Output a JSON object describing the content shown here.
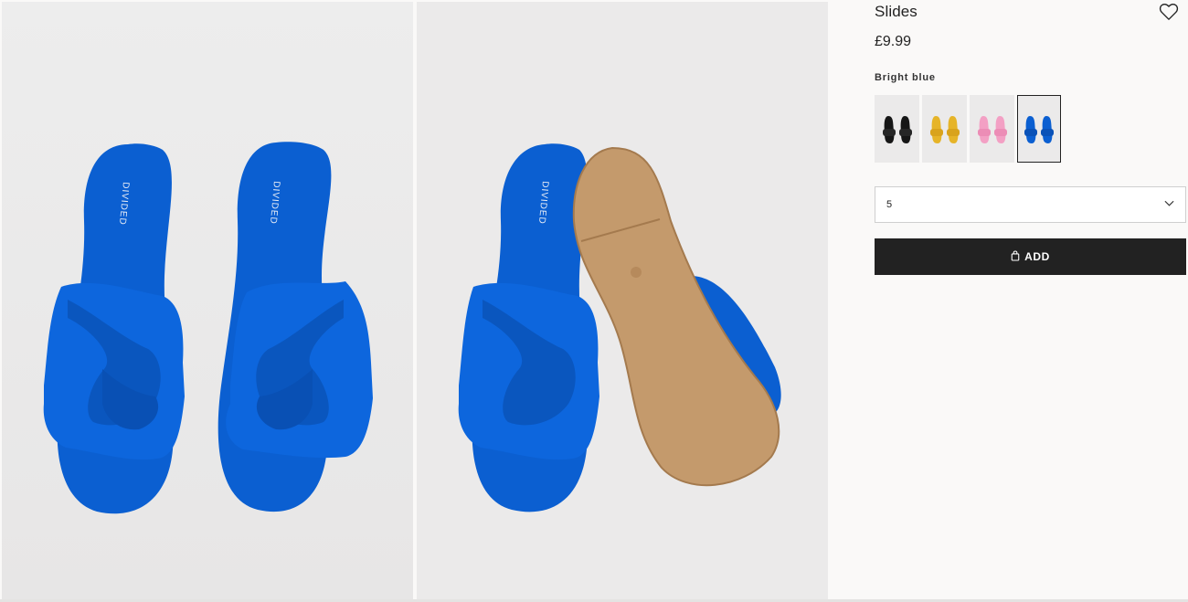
{
  "product": {
    "title": "Slides",
    "price": "£9.99",
    "selected_colour": "Bright blue",
    "swatches": [
      {
        "name": "black",
        "color": "#161616"
      },
      {
        "name": "yellow",
        "color": "#e6b428"
      },
      {
        "name": "pink",
        "color": "#f3a0c4"
      },
      {
        "name": "bright-blue",
        "color": "#0b5fd1"
      }
    ],
    "size_value": "5",
    "add_label": "ADD",
    "brand_print": "DIVIDED"
  },
  "icons": {
    "favourite": "heart-icon",
    "size_dropdown": "chevron-down-icon",
    "add": "shopping-bag-icon"
  },
  "colors": {
    "product_blue": "#0b5fd1",
    "sole_tan": "#c49a6c",
    "button_bg": "#222222",
    "photo_bg": "#ebeaea"
  }
}
